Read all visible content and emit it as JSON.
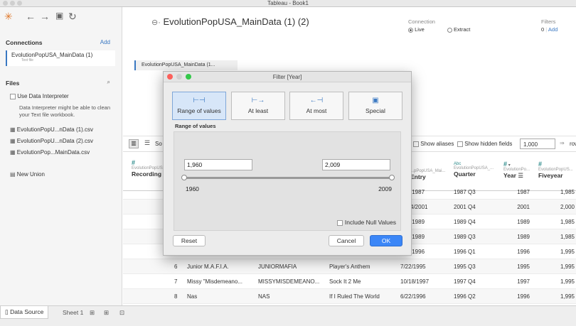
{
  "window": {
    "title": "Tableau - Book1"
  },
  "sidebar": {
    "connections_header": "Connections",
    "add_label": "Add",
    "connection": {
      "name": "EvolutionPopUSA_MainData (1)",
      "type": "Text file"
    },
    "files_header": "Files",
    "use_interpreter": "Use Data Interpreter",
    "interpreter_note": "Data Interpreter might be able to clean your Text file workbook.",
    "files": [
      "EvolutionPopU...nData (1).csv",
      "EvolutionPopU...nData (2).csv",
      "EvolutionPop...MainData.csv"
    ],
    "new_union": "New Union"
  },
  "main": {
    "datasource_title": "EvolutionPopUSA_MainData (1) (2)",
    "connection_label": "Connection",
    "live": "Live",
    "extract": "Extract",
    "filters_label": "Filters",
    "filters_count": "0",
    "filters_add": "Add",
    "canvas_table": "EvolutionPopUSA_MainData (1...",
    "sort_label": "So",
    "show_aliases": "Show aliases",
    "show_hidden": "Show hidden fields",
    "rows_value": "1,000",
    "rows_label": "rows",
    "columns": {
      "recording": {
        "src": "EvolutionPopUS...",
        "name": "Recording I"
      },
      "entry": {
        "src": "...pPopUSA_Mai...",
        "name": "Entry"
      },
      "quarter": {
        "src": "EvolutionPopUSA_...",
        "name": "Quarter",
        "type": "Abc"
      },
      "year": {
        "src": "EvolutionPo...",
        "name": "Year",
        "type": "#"
      },
      "fiveyear": {
        "src": "EvolutionPopUS...",
        "name": "Fiveyear",
        "type": "#"
      }
    },
    "rows": [
      {
        "idx": "",
        "artist": "",
        "upper": "",
        "title": "",
        "entry": "/1987",
        "quarter": "1987 Q3",
        "year": "1987",
        "five": "1,985"
      },
      {
        "idx": "",
        "artist": "",
        "upper": "",
        "title": "",
        "entry": "4/2001",
        "quarter": "2001 Q4",
        "year": "2001",
        "five": "2,000"
      },
      {
        "idx": "",
        "artist": "",
        "upper": "",
        "title": "",
        "entry": "/1989",
        "quarter": "1989 Q4",
        "year": "1989",
        "five": "1,985"
      },
      {
        "idx": "",
        "artist": "",
        "upper": "",
        "title": "",
        "entry": "/1989",
        "quarter": "1989 Q3",
        "year": "1989",
        "five": "1,985"
      },
      {
        "idx": "",
        "artist": "",
        "upper": "",
        "title": "",
        "entry": "/1996",
        "quarter": "1996 Q1",
        "year": "1996",
        "five": "1,995"
      },
      {
        "idx": "6",
        "artist": "Junior M.A.F.I.A.",
        "upper": "JUNIORMAFIA",
        "title": "Player's Anthem",
        "entry": "7/22/1995",
        "quarter": "1995 Q3",
        "year": "1995",
        "five": "1,995"
      },
      {
        "idx": "7",
        "artist": "Missy \"Misdemeano...",
        "upper": "MISSYMISDEMEANO...",
        "title": "Sock It 2 Me",
        "entry": "10/18/1997",
        "quarter": "1997 Q4",
        "year": "1997",
        "five": "1,995"
      },
      {
        "idx": "8",
        "artist": "Nas",
        "upper": "NAS",
        "title": "If I Ruled The World",
        "entry": "6/22/1996",
        "quarter": "1996 Q2",
        "year": "1996",
        "five": "1,995"
      }
    ]
  },
  "tabs": {
    "data_source": "Data Source",
    "sheet1": "Sheet 1"
  },
  "dialog": {
    "title": "Filter [Year]",
    "options": [
      "Range of values",
      "At least",
      "At most",
      "Special"
    ],
    "range_header": "Range of values",
    "min_value": "1,960",
    "max_value": "2,009",
    "min_label": "1960",
    "max_label": "2009",
    "include_null": "Include Null Values",
    "reset": "Reset",
    "cancel": "Cancel",
    "ok": "OK"
  },
  "colors": {
    "accent": "#3b86f7",
    "selected_option": "#d7e6f8"
  }
}
